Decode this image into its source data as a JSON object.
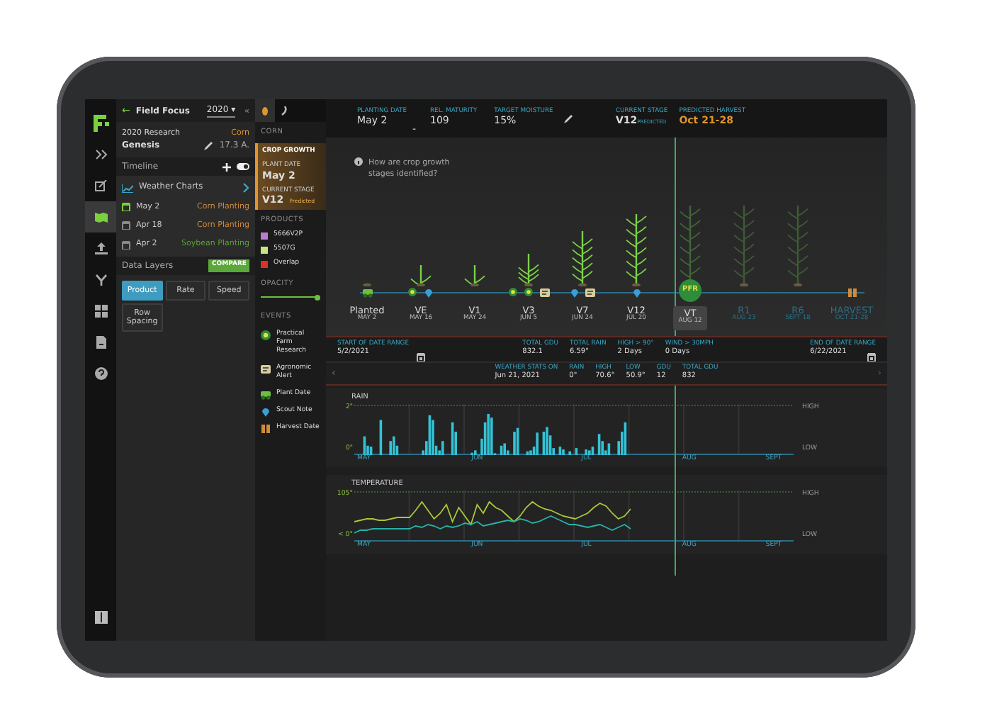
{
  "rail": [
    {
      "kind": "expand",
      "selected": false
    },
    {
      "kind": "edit",
      "selected": false
    },
    {
      "kind": "map",
      "selected": true
    },
    {
      "kind": "upload",
      "selected": false
    },
    {
      "kind": "branch",
      "selected": false
    },
    {
      "kind": "grid",
      "selected": false
    },
    {
      "kind": "report",
      "selected": false
    },
    {
      "kind": "help",
      "selected": false
    }
  ],
  "field_panel": {
    "back": "←",
    "title": "Field Focus",
    "year": "2020",
    "caret": "▾",
    "collapse": "«",
    "season": "2020 Research",
    "crop": "Corn",
    "field_name": "Genesis",
    "acres": "17.3 A."
  },
  "timeline": {
    "title": "Timeline",
    "toggle_on": true,
    "weather_charts": "Weather Charts",
    "events": [
      {
        "date": "May 2",
        "label": "Corn Planting",
        "color": "#d08a3c",
        "selected": true
      },
      {
        "date": "Apr 18",
        "label": "Corn Planting",
        "color": "#d08a3c",
        "selected": false
      },
      {
        "date": "Apr 2",
        "label": "Soybean Planting",
        "color": "#5e9e3a",
        "selected": false
      }
    ]
  },
  "data_layers": {
    "title": "Data Layers",
    "compare": "COMPARE",
    "buttons": [
      {
        "label": "Product",
        "selected": true
      },
      {
        "label": "Rate",
        "selected": false
      },
      {
        "label": "Speed",
        "selected": false
      },
      {
        "label": "Row Spacing",
        "selected": false
      }
    ]
  },
  "legend": {
    "tabs": [
      {
        "kind": "corn",
        "selected": true
      },
      {
        "kind": "soy",
        "selected": false
      }
    ],
    "crop": "CORN",
    "crop_growth": {
      "label": "CROP GROWTH",
      "selected": true
    },
    "plant_date_label": "PLANT DATE",
    "plant_date": "May 2",
    "current_stage_label": "CURRENT STAGE",
    "current_stage": "V12",
    "predicted": "Predicted",
    "products_title": "PRODUCTS",
    "products": [
      {
        "name": "5666V2P",
        "color": "#b87fd0"
      },
      {
        "name": "5507G",
        "color": "#c8e47c"
      },
      {
        "name": "Overlap",
        "color": "#e0301e"
      }
    ],
    "opacity_title": "OPACITY",
    "opacity": {
      "level": 0.95
    },
    "events_title": "EVENTS",
    "events": [
      {
        "kind": "pfr",
        "label": "Practical Farm Research"
      },
      {
        "kind": "alert",
        "label": "Agronomic Alert"
      },
      {
        "kind": "plant",
        "label": "Plant Date"
      },
      {
        "kind": "scout",
        "label": "Scout Note"
      },
      {
        "kind": "harvest",
        "label": "Harvest Date"
      }
    ]
  },
  "header": {
    "planting_date": {
      "label": "PLANTING DATE",
      "value": "May 2"
    },
    "dash": "-",
    "rel_maturity": {
      "label": "REL. MATURITY",
      "value": "109"
    },
    "target_moisture": {
      "label": "TARGET MOISTURE",
      "value": "15%"
    },
    "current_stage": {
      "label": "CURRENT STAGE",
      "value": "V12",
      "note": "PREDICTED"
    },
    "predicted_harvest": {
      "label": "PREDICTED HARVEST",
      "value": "Oct 21-28"
    }
  },
  "help": {
    "text": "How are crop growth stages identified?"
  },
  "stages": [
    {
      "name": "Planted",
      "date": "MAY 2",
      "selected": false,
      "predicted": false,
      "markers": [
        {
          "kind": "plant"
        }
      ]
    },
    {
      "name": "VE",
      "date": "MAY 16",
      "selected": false,
      "predicted": false,
      "markers": [
        {
          "kind": "pfr"
        },
        {
          "kind": "scout"
        }
      ]
    },
    {
      "name": "V1",
      "date": "MAY 24",
      "selected": false,
      "predicted": false
    },
    {
      "name": "V3",
      "date": "JUN 5",
      "selected": false,
      "predicted": false,
      "markers": [
        {
          "kind": "pfr"
        },
        {
          "kind": "pfr"
        },
        {
          "kind": "alert"
        }
      ]
    },
    {
      "name": "V7",
      "date": "JUN 24",
      "selected": false,
      "predicted": false,
      "markers": [
        {
          "kind": "scout"
        },
        {
          "kind": "alert"
        }
      ]
    },
    {
      "name": "V12",
      "date": "JUL 20",
      "selected": false,
      "predicted": false,
      "markers": [
        {
          "kind": "scout"
        }
      ]
    },
    {
      "name": "VT",
      "date": "AUG 12",
      "selected": true,
      "predicted": false,
      "badge": "PFR"
    },
    {
      "name": "R1",
      "date": "AUG 23",
      "selected": false,
      "predicted": true
    },
    {
      "name": "R6",
      "date": "SEPT 18",
      "selected": false,
      "predicted": true
    },
    {
      "name": "HARVEST",
      "date": "OCT 21-28",
      "selected": false,
      "predicted": true,
      "markers": [
        {
          "kind": "harvest"
        }
      ]
    }
  ],
  "range_bar": {
    "start_label": "START OF DATE RANGE",
    "start": "5/2/2021",
    "stats": [
      {
        "label": "TOTAL GDU",
        "value": "832.1"
      },
      {
        "label": "TOTAL RAIN",
        "value": "6.59\""
      },
      {
        "label": "HIGH > 90°",
        "value": "2 Days"
      },
      {
        "label": "WIND > 30MPH",
        "value": "0 Days"
      }
    ],
    "end_label": "END OF DATE RANGE",
    "end": "6/22/2021"
  },
  "weather_stats": {
    "prev": "‹",
    "next": "›",
    "items": [
      {
        "label": "WEATHER STATS ON",
        "value": "Jun 21, 2021"
      },
      {
        "label": "RAIN",
        "value": "0\""
      },
      {
        "label": "HIGH",
        "value": "70.6°"
      },
      {
        "label": "LOW",
        "value": "50.9°"
      },
      {
        "label": "GDU",
        "value": "12"
      },
      {
        "label": "TOTAL GDU",
        "value": "832"
      }
    ]
  },
  "rain_chart": {
    "title": "RAIN",
    "y_top": "2\"",
    "y_bottom": "0\"",
    "high": "HIGH",
    "low": "LOW",
    "months": [
      "MAY",
      "JUN",
      "JUL",
      "AUG",
      "SEPT"
    ]
  },
  "temperature_chart": {
    "title": "TEMPERATURE",
    "y_top": "105°",
    "y_bottom": "< 0°",
    "high": "HIGH",
    "low": "LOW",
    "months": [
      "MAY",
      "JUN",
      "JUL",
      "AUG",
      "SEPT"
    ]
  }
}
